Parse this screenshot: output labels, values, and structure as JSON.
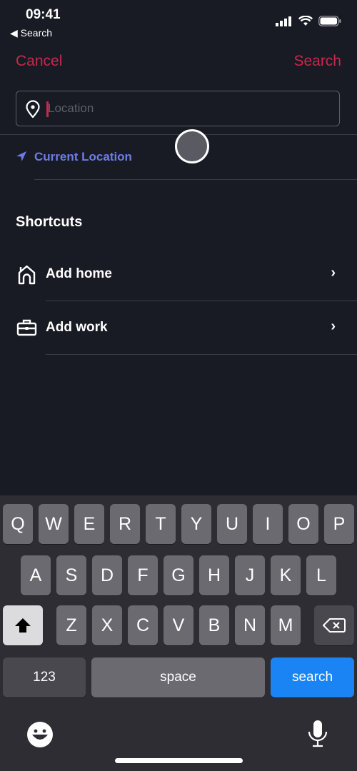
{
  "status_bar": {
    "time": "09:41",
    "back_label": "◀ Search"
  },
  "nav": {
    "cancel_label": "Cancel",
    "search_label": "Search"
  },
  "location_input": {
    "placeholder": "Location",
    "value": ""
  },
  "current_location": {
    "label": "Current Location"
  },
  "shortcuts": {
    "heading": "Shortcuts",
    "items": [
      {
        "label": "Add home",
        "icon": "home-icon"
      },
      {
        "label": "Add work",
        "icon": "briefcase-icon"
      }
    ]
  },
  "keyboard": {
    "row1": [
      "Q",
      "W",
      "E",
      "R",
      "T",
      "Y",
      "U",
      "I",
      "O",
      "P"
    ],
    "row2": [
      "A",
      "S",
      "D",
      "F",
      "G",
      "H",
      "J",
      "K",
      "L"
    ],
    "row3": [
      "Z",
      "X",
      "C",
      "V",
      "B",
      "N",
      "M"
    ],
    "numbers_label": "123",
    "space_label": "space",
    "search_label": "search"
  },
  "colors": {
    "accent": "#c8294a",
    "link": "#6d7de8",
    "keyboard_action": "#1a84f5"
  }
}
